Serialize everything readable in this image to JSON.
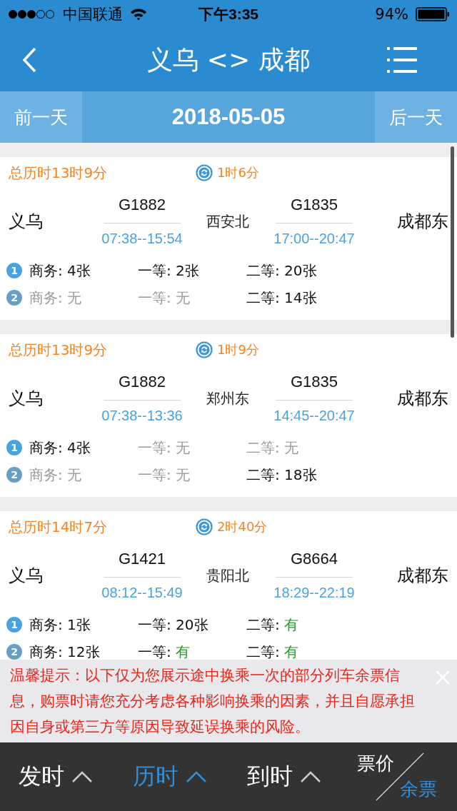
{
  "status_bar": {
    "carrier": "中国联通",
    "time": "下午3:35",
    "battery": "94%"
  },
  "nav": {
    "title": "义乌 <> 成都"
  },
  "date_bar": {
    "prev": "前一天",
    "date": "2018-05-05",
    "next": "后一天"
  },
  "routes": [
    {
      "total": "总历时13时9分",
      "transfer": "1时6分",
      "origin": "义乌",
      "via": "西安北",
      "destination": "成都东",
      "legs": [
        {
          "train": "G1882",
          "time": "07:38--15:54"
        },
        {
          "train": "G1835",
          "time": "17:00--20:47"
        }
      ],
      "seat_rows": [
        {
          "badge": "1",
          "seats": [
            {
              "label": "商务:",
              "value": "4张",
              "sold_out": false,
              "ample": false
            },
            {
              "label": "一等:",
              "value": "2张",
              "sold_out": false,
              "ample": false
            },
            {
              "label": "二等:",
              "value": "20张",
              "sold_out": false,
              "ample": false
            }
          ]
        },
        {
          "badge": "2",
          "seats": [
            {
              "label": "商务:",
              "value": "无",
              "sold_out": true,
              "ample": false
            },
            {
              "label": "一等:",
              "value": "无",
              "sold_out": true,
              "ample": false
            },
            {
              "label": "二等:",
              "value": "14张",
              "sold_out": false,
              "ample": false
            }
          ]
        }
      ]
    },
    {
      "total": "总历时13时9分",
      "transfer": "1时9分",
      "origin": "义乌",
      "via": "郑州东",
      "destination": "成都东",
      "legs": [
        {
          "train": "G1882",
          "time": "07:38--13:36"
        },
        {
          "train": "G1835",
          "time": "14:45--20:47"
        }
      ],
      "seat_rows": [
        {
          "badge": "1",
          "seats": [
            {
              "label": "商务:",
              "value": "4张",
              "sold_out": false,
              "ample": false
            },
            {
              "label": "一等:",
              "value": "无",
              "sold_out": true,
              "ample": false
            },
            {
              "label": "二等:",
              "value": "无",
              "sold_out": true,
              "ample": false
            }
          ]
        },
        {
          "badge": "2",
          "seats": [
            {
              "label": "商务:",
              "value": "无",
              "sold_out": true,
              "ample": false
            },
            {
              "label": "一等:",
              "value": "无",
              "sold_out": true,
              "ample": false
            },
            {
              "label": "二等:",
              "value": "18张",
              "sold_out": false,
              "ample": false
            }
          ]
        }
      ]
    },
    {
      "total": "总历时14时7分",
      "transfer": "2时40分",
      "origin": "义乌",
      "via": "贵阳北",
      "destination": "成都东",
      "legs": [
        {
          "train": "G1421",
          "time": "08:12--15:49"
        },
        {
          "train": "G8664",
          "time": "18:29--22:19"
        }
      ],
      "seat_rows": [
        {
          "badge": "1",
          "seats": [
            {
              "label": "商务:",
              "value": "1张",
              "sold_out": false,
              "ample": false
            },
            {
              "label": "一等:",
              "value": "20张",
              "sold_out": false,
              "ample": false
            },
            {
              "label": "二等:",
              "value": "有",
              "sold_out": false,
              "ample": true
            }
          ]
        },
        {
          "badge": "2",
          "seats": [
            {
              "label": "商务:",
              "value": "12张",
              "sold_out": false,
              "ample": false
            },
            {
              "label": "一等:",
              "value": "有",
              "sold_out": false,
              "ample": true
            },
            {
              "label": "二等:",
              "value": "有",
              "sold_out": false,
              "ample": true
            }
          ]
        }
      ]
    }
  ],
  "notice": {
    "text": "温馨提示：以下仅为您展示途中换乘一次的部分列车余票信息，购票时请您充分考虑各种影响换乘的因素，并且自愿承担因自身或第三方等原因导致延误换乘的风险。"
  },
  "sort_bar": {
    "options": [
      {
        "label": "发时",
        "selected": false
      },
      {
        "label": "历时",
        "selected": true
      },
      {
        "label": "到时",
        "selected": false
      }
    ],
    "toggle": [
      {
        "label": "票价",
        "selected": false
      },
      {
        "label": "余票",
        "selected": true
      }
    ]
  }
}
